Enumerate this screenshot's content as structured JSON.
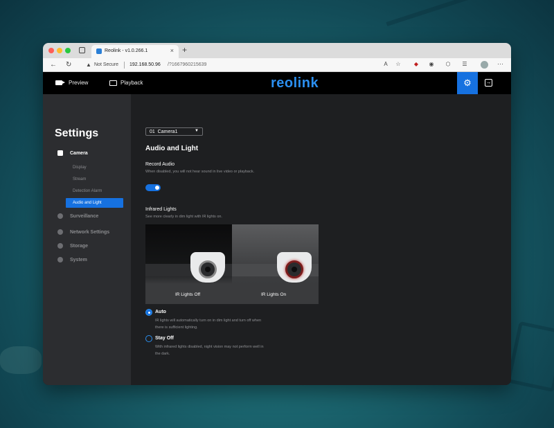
{
  "browser": {
    "tab_title": "Reolink - v1.0.266.1",
    "tab_close": "×",
    "new_tab": "+",
    "not_secure": "Not Secure",
    "url_host": "192.168.50.96",
    "url_path": "/?1667960215639",
    "more": "···",
    "icons": [
      "back-arrow-icon",
      "reload-icon",
      "warning-icon",
      "read-aloud-icon",
      "favorites-icon",
      "extension-icon",
      "profile-icon",
      "more-icon"
    ]
  },
  "header": {
    "preview_label": "Preview",
    "playback_label": "Playback",
    "logo": "reolink",
    "accent": "#1671e0"
  },
  "sidebar": {
    "title": "Settings",
    "items": [
      {
        "label": "Camera",
        "icon": "camera-icon"
      },
      {
        "label": "Surveillance",
        "icon": "shield-icon"
      },
      {
        "label": "Network Settings",
        "icon": "globe-icon"
      },
      {
        "label": "Storage",
        "icon": "storage-icon"
      },
      {
        "label": "System",
        "icon": "gear-icon"
      }
    ],
    "camera_sub": [
      "Display",
      "Stream",
      "Detection Alarm",
      "Audio and Light"
    ],
    "active_sub": "Audio and Light"
  },
  "content": {
    "camera_select": "01  Camera1",
    "section_title": "Audio and Light",
    "record_audio": {
      "label": "Record Audio",
      "hint": "When disabled, you will not hear sound in live video or playback.",
      "enabled": true
    },
    "infrared": {
      "label": "Infrared Lights",
      "hint": "See more clearly in dim light with IR lights on.",
      "off_label": "IR Lights Off",
      "on_label": "IR Lights On"
    },
    "options": [
      {
        "label": "Auto",
        "hint": "IR lights will automatically turn on in dim light and turn off when there is sufficient lighting.",
        "selected": true
      },
      {
        "label": "Stay Off",
        "hint": "With infrared lights disabled, night vision may not perform well in the dark.",
        "selected": false
      }
    ]
  }
}
